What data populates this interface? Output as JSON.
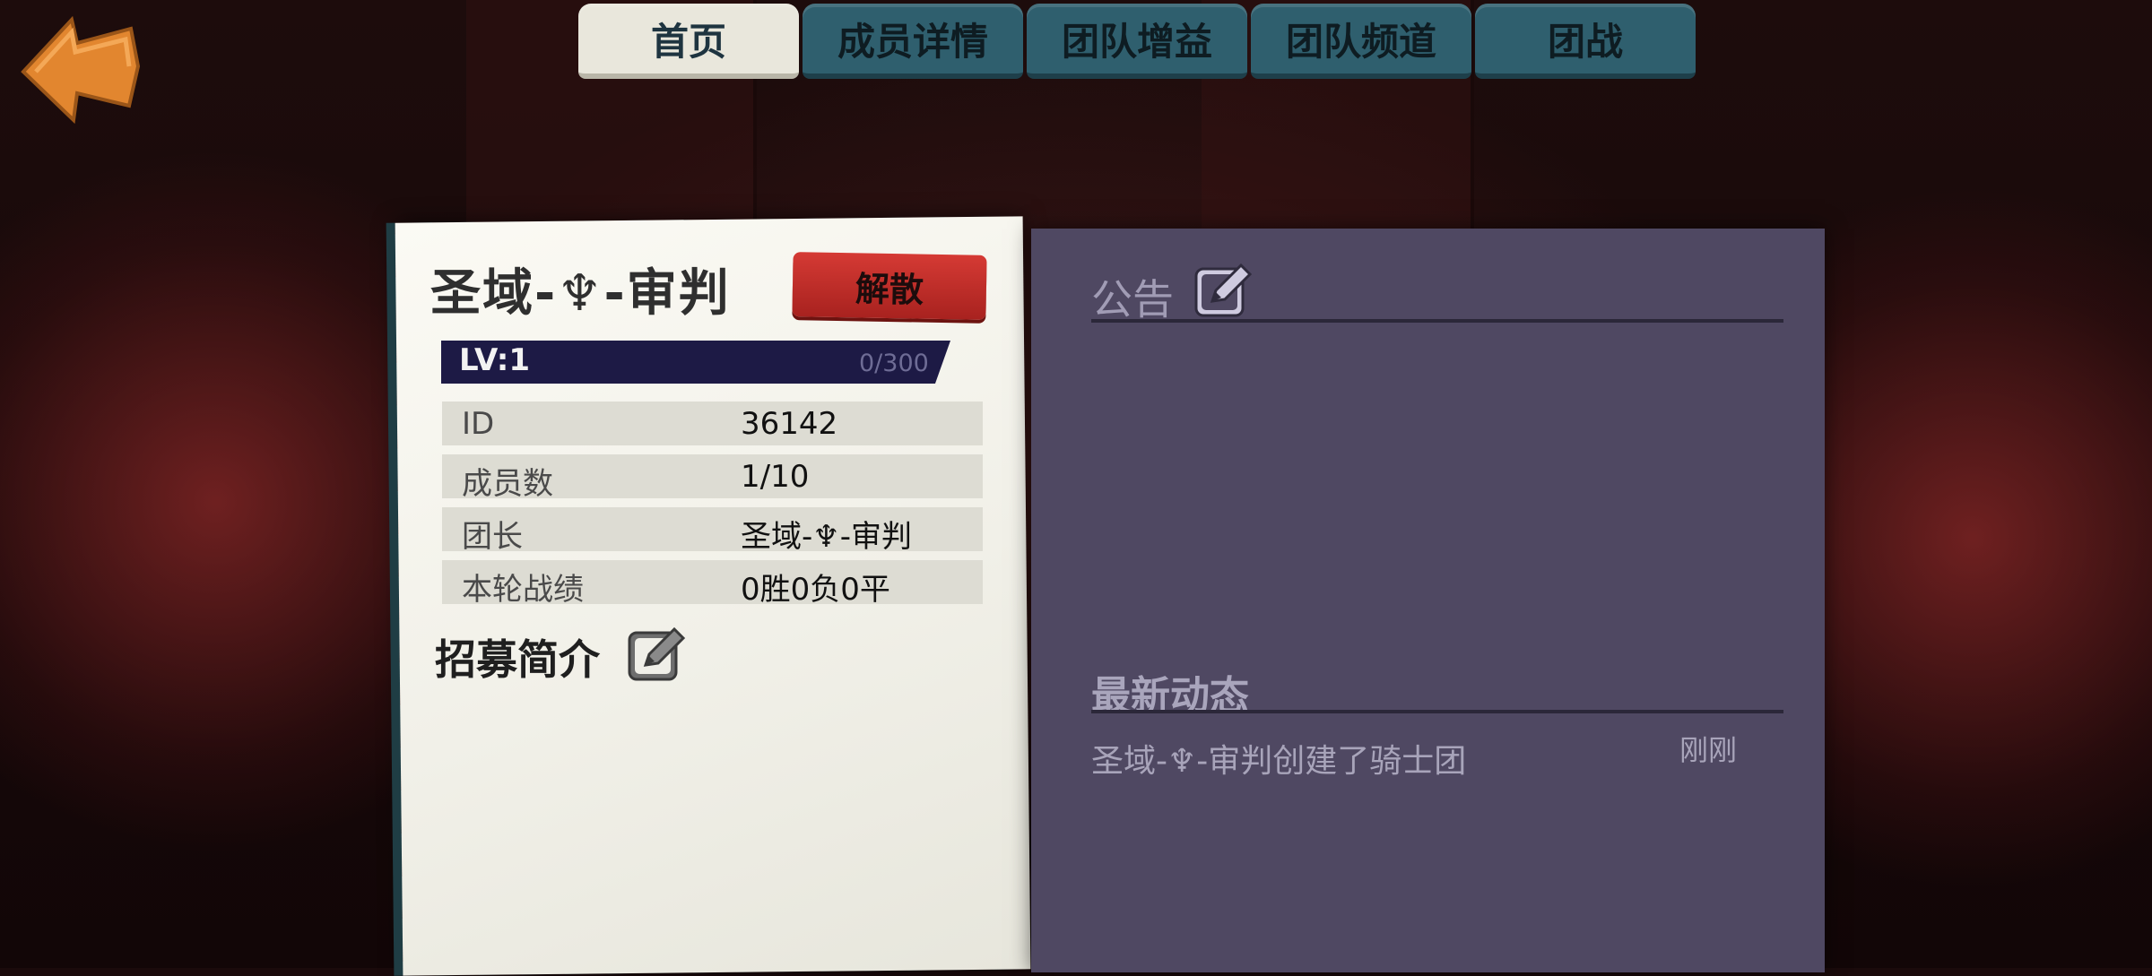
{
  "tabs": [
    {
      "label": "首页",
      "active": true
    },
    {
      "label": "成员详情",
      "active": false
    },
    {
      "label": "团队增益",
      "active": false
    },
    {
      "label": "团队频道",
      "active": false
    },
    {
      "label": "团战",
      "active": false
    }
  ],
  "guild": {
    "name": "圣域-♆-审判",
    "disband_label": "解散",
    "level_label": "LV:1",
    "progress": "0/300",
    "progress_fraction": 0,
    "info": [
      {
        "key": "ID",
        "value": "36142"
      },
      {
        "key": "成员数",
        "value": "1/10"
      },
      {
        "key": "团长",
        "value": "圣域-♆-审判"
      },
      {
        "key": "本轮战绩",
        "value": "0胜0负0平"
      }
    ],
    "recruit_title": "招募简介"
  },
  "announcement": {
    "title": "公告"
  },
  "news": {
    "title": "最新动态",
    "items": [
      {
        "text": "圣域-♆-审判创建了骑士团",
        "time": "刚刚"
      }
    ]
  },
  "colors": {
    "back_arrow": "#e2862f",
    "tab_active": "#e9e7dc",
    "tab_inactive": "#2f5f6e",
    "disband": "#c83430",
    "level_bar": "#1d1a45",
    "panel": "#4f4862"
  },
  "icons": {
    "back": "arrow-left-icon",
    "edit": "pencil-edit-icon"
  }
}
